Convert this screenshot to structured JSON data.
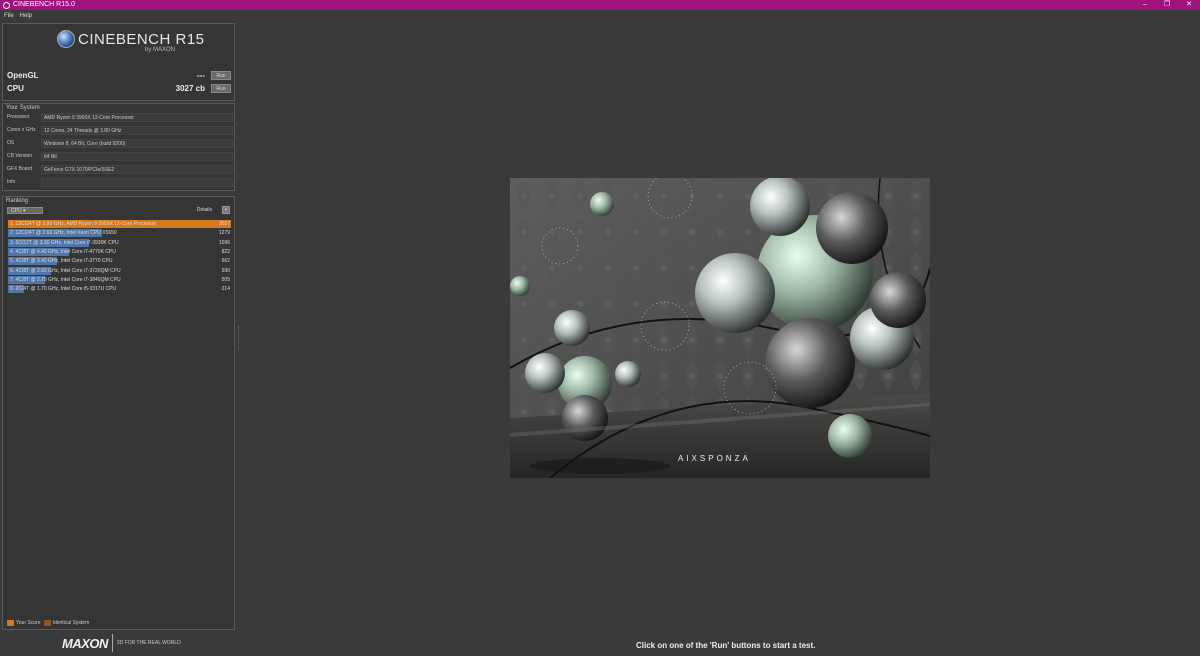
{
  "window": {
    "title": "CINEBENCH R15.0",
    "controls": [
      "–",
      "❐",
      "✕"
    ]
  },
  "menu": {
    "items": [
      "File",
      "Help"
    ]
  },
  "logo": {
    "brand": "CINEBENCH R15",
    "byline": "by MAXON"
  },
  "benchmarks": [
    {
      "name": "OpenGL",
      "score": "---",
      "run_label": "Run"
    },
    {
      "name": "CPU",
      "score": "3027 cb",
      "run_label": "Run"
    }
  ],
  "system": {
    "title": "Your System",
    "rows": [
      {
        "label": "Processor",
        "value": "AMD Ryzen 9 3900X 12-Core Processor"
      },
      {
        "label": "Cores x GHz",
        "value": "12 Cores, 24 Threads @ 3.80 GHz"
      },
      {
        "label": "OS",
        "value": "Windows 8, 64 Bit, Core (build 9200)"
      },
      {
        "label": "CB Version",
        "value": "64 Bit"
      },
      {
        "label": "GFX Board",
        "value": "GeForce GTX 1070/PCIe/SSE2"
      },
      {
        "label": "Info",
        "value": ""
      }
    ]
  },
  "ranking": {
    "title": "Ranking",
    "select": "CPU",
    "details_label": "Details",
    "details_btn": "»",
    "max_value": 3027,
    "rows": [
      {
        "text": "1. 12C/24T @ 3.80 GHz, AMD Ryzen 9 3900X 12-Core Processor",
        "value": 3027,
        "mine": true
      },
      {
        "text": "2. 12C/24T @ 2.66 GHz, Intel Xeon CPU X5650",
        "value": 1279,
        "mine": false
      },
      {
        "text": "3. 6C/12T @ 3.30 GHz, Intel Core i7-3930K CPU",
        "value": 1096,
        "mine": false
      },
      {
        "text": "4. 4C/8T @ 4.40 GHz, Intel Core i7-4770K CPU",
        "value": 822,
        "mine": false
      },
      {
        "text": "5. 4C/8T @ 3.40 GHz, Intel Core i7-3770 CPU",
        "value": 662,
        "mine": false
      },
      {
        "text": "6. 4C/8T @ 2.60 GHz, Intel Core i7-3720QM CPU",
        "value": 590,
        "mine": false
      },
      {
        "text": "7. 4C/8T @ 2.79 GHz, Intel Core i7-3840QM CPU",
        "value": 505,
        "mine": false
      },
      {
        "text": "8. 2C/4T @ 1.70 GHz, Intel Core i5-3317U CPU",
        "value": 214,
        "mine": false
      }
    ],
    "legend": [
      {
        "label": "Your Score",
        "color": "#d57a1e"
      },
      {
        "label": "Identical System",
        "color": "#8a5a2a"
      }
    ]
  },
  "footer": {
    "mark": "MAXON",
    "tagline": "3D FOR THE REAL WORLD"
  },
  "status": "Click on one of the 'Run' buttons to start a test.",
  "render": {
    "caption": "AIXSPONZA"
  }
}
